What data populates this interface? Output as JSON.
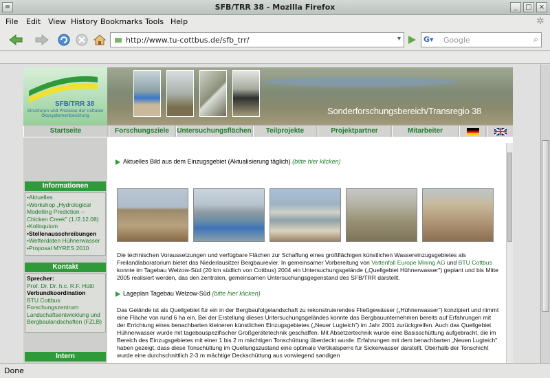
{
  "window": {
    "title": "SFB/TRR 38 - Mozilla Firefox"
  },
  "menu": [
    "File",
    "Edit",
    "View",
    "History",
    "Bookmarks",
    "Tools",
    "Help"
  ],
  "toolbar": {
    "url": "http://www.tu-cottbus.de/sfb_trr/",
    "search_placeholder": "Google"
  },
  "banner": {
    "logo_text": "SFB/TRR 38",
    "logo_sub": "Strukturen und Prozesse der initialen Ökosystementwicklung",
    "subtitle": "Sonderforschungsbereich/Transregio 38"
  },
  "nav": [
    "Startseite",
    "Forschungsziele",
    "Untersuchungsflächen",
    "Teilprojekte",
    "Projektpartner",
    "Mitarbeiter"
  ],
  "sidebar": {
    "info_head": "Informationen",
    "info_items": [
      "•Aktuelles",
      "•Workshop „Hydrological Modelling Prediction – Chicken Creek\" (1./2.12.08)",
      "•Kolloquium",
      "•Stellenausschreibungen",
      "•Wetterdaten Hühnerwasser",
      "•Proposal MYRES 2010"
    ],
    "kontakt_head": "Kontakt",
    "kontakt_lines": [
      "Sprecher:",
      "Prof. Dr. Dr. h.c. R.F. Hüttl",
      "Verbundkoordination",
      "BTU Cottbus",
      "Forschungszentrum",
      "Landschaftsentwicklung und",
      "Bergbaulandschaften (FZLB)"
    ],
    "intern_head": "Intern"
  },
  "main": {
    "bullet1": "Aktuelles Bild aus dem Einzugsgebiet (Aktualisierung täglich)",
    "bullet1_link": "(bitte hier klicken)",
    "para1": "Die technischen Voraussetzungen und verfügbare Flächen zur Schaffung eines großflächigen künstlichen Wassereinzugsgebietes als Freilandlaboratorium bietet das Niederlausitzer Bergbaurevier. In gemeinsamer Vorbereitung von",
    "para1_link1": "Vattenfall Europe Mining AG",
    "para1_mid": "und",
    "para1_link2": "BTU Cottbus",
    "para1_end": "konnte im Tagebau Welzow-Süd (20 km südlich von Cottbus) 2004 ein Untersuchungsgelände („Quellgebiet Hühnerwasser\") geplant und bis Mitte 2005 realisiert werden, das den zentralen, gemeinsamen Untersuchungsgegenstand des SFB/TRR darstellt.",
    "bullet2": "Lageplan Tagebau Welzow-Süd",
    "bullet2_link": "(bitte hier klicken)",
    "para2": "Das Gelände ist als Quellgebiet für ein in der Bergbaufolgelandschaft zu rekonstruierendes Fließgewässer („Hühnerwasser\") konzipiert und nimmt eine Fläche von rund 6 ha ein. Bei der Erstellung dieses Untersuchungsgeländes konnte das Bergbauunternehmen bereits auf Erfahrungen mit der Errichtung eines benachbarten kleineren künstlichen Einzugsgebietes („Neuer Lugteich\") im Jahr 2001 zurückgreifen. Auch das Quellgebiet Hühnerwasser wurde mit tagebauspezifischer Großgerätetechnik geschaffen. Mit Absetzertechnik wurde eine Basisschüttung aufgebracht, die im Bereich des Einzugsgebietes mit einer 1 bis 2 m mächtigen Tonschüttung überdeckt wurde. Erfahrungen mit dem benachbarten „Neuen Lugteich\" haben gezeigt, dass diese Tonschüttung im Quellungszustand eine optimale Vertikalsperre für Sickerwasser darstellt. Oberhalb der Tonschicht wurde eine durchschnittlich 2-3 m mächtige Deckschüttung aus vorwiegend sandigen"
  },
  "status": {
    "text": "Done"
  },
  "colors": {
    "accent": "#2f9a3a",
    "link": "#1f7a2c"
  }
}
